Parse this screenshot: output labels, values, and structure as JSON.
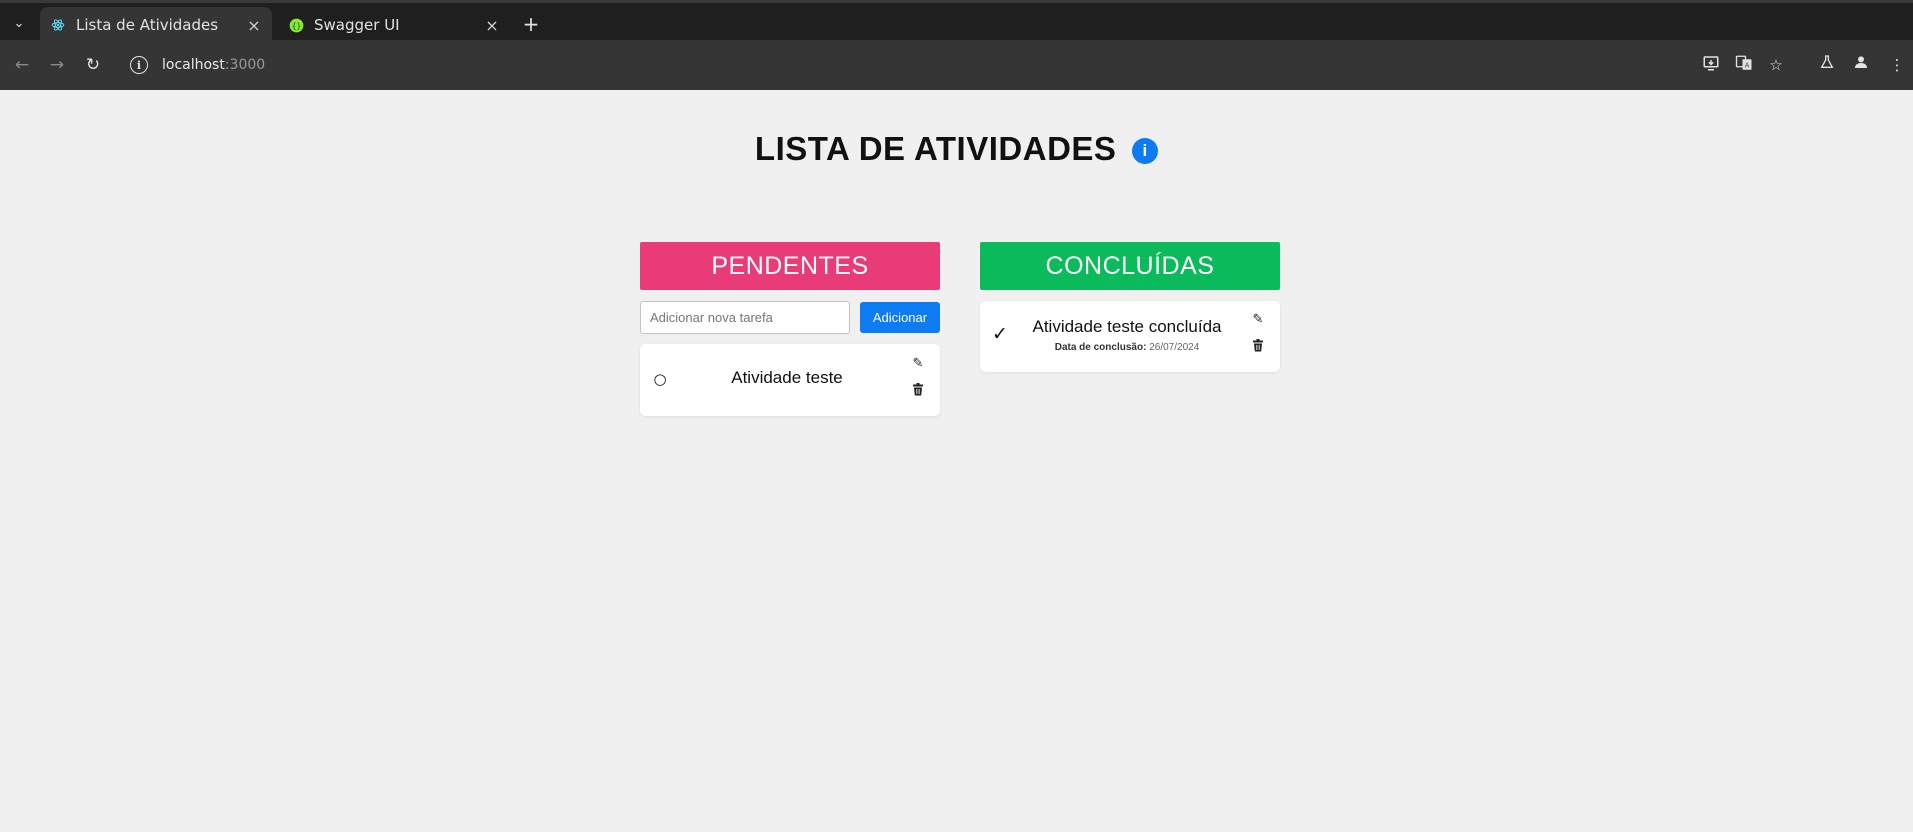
{
  "browser": {
    "tabs": [
      {
        "title": "Lista de Atividades",
        "icon": "react-icon",
        "active": true
      },
      {
        "title": "Swagger UI",
        "icon": "swagger-icon",
        "active": false
      }
    ],
    "close_glyph": "×",
    "new_tab_glyph": "+",
    "url_host": "localhost",
    "url_port": ":3000"
  },
  "page": {
    "title": "LISTA DE ATIVIDADES",
    "info_badge": "i"
  },
  "pending": {
    "header": "PENDENTES",
    "input_placeholder": "Adicionar nova tarefa",
    "add_button": "Adicionar",
    "tasks": [
      {
        "status_glyph": "○",
        "text": "Atividade teste"
      }
    ]
  },
  "completed": {
    "header": "CONCLUÍDAS",
    "tasks": [
      {
        "status_glyph": "✓",
        "text": "Atividade teste concluída",
        "date_label": "Data de conclusão:",
        "date_value": "26/07/2024"
      }
    ]
  },
  "colors": {
    "pending_header": "#e83b77",
    "completed_header": "#0bba5b",
    "accent_blue": "#0d7bf2"
  }
}
